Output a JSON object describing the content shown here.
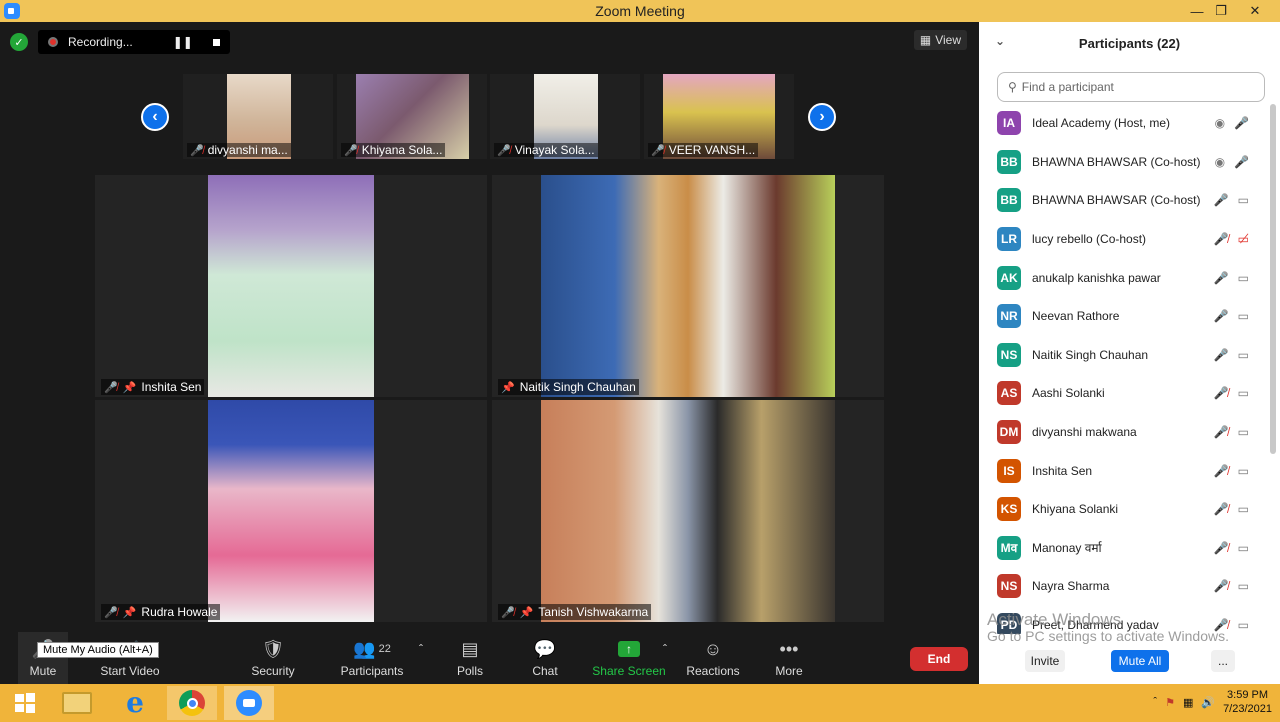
{
  "window": {
    "title": "Zoom Meeting"
  },
  "topbar": {
    "recording_label": "Recording...",
    "view_label": "View"
  },
  "thumbnails": [
    {
      "name": "divyanshi ma..."
    },
    {
      "name": "Khiyana Sola..."
    },
    {
      "name": "Vinayak Sola..."
    },
    {
      "name": "VEER VANSH..."
    }
  ],
  "tiles": [
    {
      "name": "Inshita Sen",
      "muted": true
    },
    {
      "name": "Naitik Singh Chauhan",
      "muted": false
    },
    {
      "name": "Rudra Howale",
      "muted": true
    },
    {
      "name": "Tanish Vishwakarma",
      "muted": true
    }
  ],
  "toolbar": {
    "mute": "Mute",
    "start_video": "Start Video",
    "security": "Security",
    "participants": "Participants",
    "participants_count": "22",
    "polls": "Polls",
    "chat": "Chat",
    "share_screen": "Share Screen",
    "reactions": "Reactions",
    "more": "More",
    "end": "End",
    "tooltip": "Mute My Audio (Alt+A)"
  },
  "panel": {
    "title": "Participants (22)",
    "search_placeholder": "Find a participant",
    "participants": [
      {
        "initials": "IA",
        "name": "Ideal Academy (Host, me)",
        "color": "#8e44ad",
        "audio": "on",
        "video": "rec"
      },
      {
        "initials": "BB",
        "name": "BHAWNA BHAWSAR (Co-host)",
        "color": "#16a085",
        "audio": "on",
        "video": "rec"
      },
      {
        "initials": "BB",
        "name": "BHAWNA BHAWSAR (Co-host)",
        "color": "#16a085",
        "audio": "on",
        "video": "on"
      },
      {
        "initials": "LR",
        "name": "lucy rebello (Co-host)",
        "color": "#2e86c1",
        "audio": "off",
        "video": "off"
      },
      {
        "initials": "AK",
        "name": "anukalp kanishka pawar",
        "color": "#16a085",
        "audio": "on",
        "video": "on"
      },
      {
        "initials": "NR",
        "name": "Neevan Rathore",
        "color": "#2e86c1",
        "audio": "on",
        "video": "on"
      },
      {
        "initials": "NS",
        "name": "Naitik Singh Chauhan",
        "color": "#16a085",
        "audio": "on",
        "video": "on"
      },
      {
        "initials": "AS",
        "name": "Aashi Solanki",
        "color": "#c0392b",
        "audio": "off",
        "video": "on"
      },
      {
        "initials": "DM",
        "name": "divyanshi makwana",
        "color": "#c0392b",
        "audio": "off",
        "video": "on"
      },
      {
        "initials": "IS",
        "name": "Inshita Sen",
        "color": "#d35400",
        "audio": "off",
        "video": "on"
      },
      {
        "initials": "KS",
        "name": "Khiyana Solanki",
        "color": "#d35400",
        "audio": "off",
        "video": "on"
      },
      {
        "initials": "Mव",
        "name": "Manonay वर्मा",
        "color": "#16a085",
        "audio": "off",
        "video": "on"
      },
      {
        "initials": "NS",
        "name": "Nayra Sharma",
        "color": "#c0392b",
        "audio": "off",
        "video": "on"
      },
      {
        "initials": "PD",
        "name": "Preet, Dharmend yadav",
        "color": "#34495e",
        "audio": "off",
        "video": "on"
      }
    ],
    "invite": "Invite",
    "mute_all": "Mute All",
    "more": "..."
  },
  "watermark": {
    "line1": "Activate Windows",
    "line2": "Go to PC settings to activate Windows."
  },
  "taskbar": {
    "time": "3:59 PM",
    "date": "7/23/2021"
  }
}
